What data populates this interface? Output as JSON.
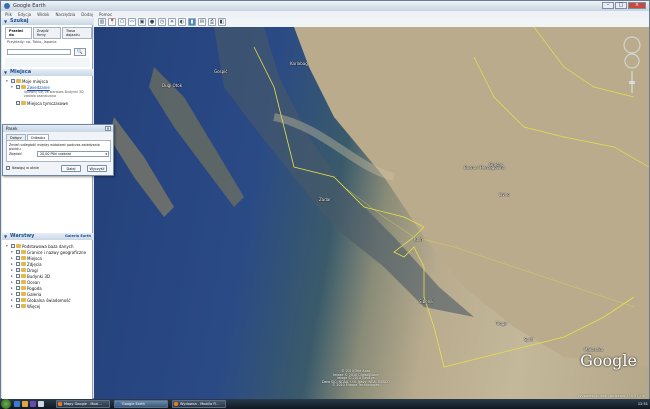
{
  "window": {
    "title": "Google Earth"
  },
  "menu": [
    "Plik",
    "Edycja",
    "Widok",
    "Narzędzia",
    "Dodaj",
    "Pomoc"
  ],
  "toolbar_icons": [
    "sidebar-toggle-icon",
    "placemark-icon",
    "polygon-icon",
    "path-icon",
    "image-overlay-icon",
    "record-tour-icon",
    "historical-imagery-icon",
    "sun-icon",
    "planet-icon",
    "ruler-icon",
    "email-icon",
    "print-icon",
    "view-in-maps-icon"
  ],
  "search": {
    "header": "Szukaj",
    "tabs": [
      "Przeleć do",
      "Znajdź firmy",
      "Trasa dojazdu"
    ],
    "hint": "Przykłady: np. Tokio, Japonia",
    "input_value": "",
    "go_label": "🔍"
  },
  "places": {
    "header": "Miejsca",
    "items": [
      {
        "label": "Moje miejsca",
        "checked": true
      },
      {
        "label": "Zwiedzanie",
        "checked": true,
        "link": true
      },
      {
        "label": "Miejsca tymczasowe",
        "checked": true
      }
    ],
    "sub": "Upewnij się, że warstwa Budynki 3D została zaznaczona"
  },
  "dialog": {
    "title": "Pasek",
    "tabs": [
      "Dołącz",
      "Odtwórz"
    ],
    "text": "Zmień odległość między widokami podczas zwiedzania punktu",
    "field_label": "Zbędzić",
    "field_value": "20,00 Pliki rozdział",
    "footer_check": "Nawiguj w oknie",
    "ok": "Dalej",
    "cancel": "Wyczyść"
  },
  "layers": {
    "header": "Warstwy",
    "gallery": "Galeria Earth",
    "items": [
      {
        "label": "Podstawowa baza danych",
        "checked": true
      },
      {
        "label": "Granice i nazwy geograficzne",
        "checked": true
      },
      {
        "label": "Miejsca",
        "checked": true
      },
      {
        "label": "Zdjęcia",
        "checked": false
      },
      {
        "label": "Drogi",
        "checked": true
      },
      {
        "label": "Budynki 3D",
        "checked": false
      },
      {
        "label": "Ocean",
        "checked": false
      },
      {
        "label": "Pogoda",
        "checked": false
      },
      {
        "label": "Galeria",
        "checked": false
      },
      {
        "label": "Globalna świadomość",
        "checked": false
      },
      {
        "label": "Więcej",
        "checked": false
      }
    ]
  },
  "map": {
    "labels": [
      {
        "text": "Gospić",
        "cls": "l1"
      },
      {
        "text": "Karlobag",
        "cls": "l2"
      },
      {
        "text": "Gračac",
        "cls": "l3"
      },
      {
        "text": "Zadar",
        "cls": "l4"
      },
      {
        "text": "Knin",
        "cls": "l5"
      },
      {
        "text": "Šibenik",
        "cls": "l6"
      },
      {
        "text": "Split",
        "cls": "l7"
      },
      {
        "text": "Makarska",
        "cls": "l8"
      },
      {
        "text": "Trogir",
        "cls": "l9"
      },
      {
        "text": "Livno",
        "cls": "l10"
      },
      {
        "text": "Dugi Otok",
        "cls": "l11"
      },
      {
        "text": "Bosna i Hercegovina",
        "cls": "l12"
      }
    ],
    "copyright": [
      "© 2010 Tele Atlas",
      "Image © 2010 DigitalGlobe",
      "Image © 2010 GeoEye",
      "Data SIO, NOAA, U.S. Navy, NGA, GEBCO",
      "© 2010 Europa Technologies"
    ],
    "logo": "Google",
    "status": "Wysokość punktu widzenia 136,37 km"
  },
  "taskbar": {
    "tasks": [
      "Mapy Google - Mozi...",
      "Google Earth",
      "Wydawca - Mozilla Fi..."
    ],
    "clock": "12:51"
  }
}
